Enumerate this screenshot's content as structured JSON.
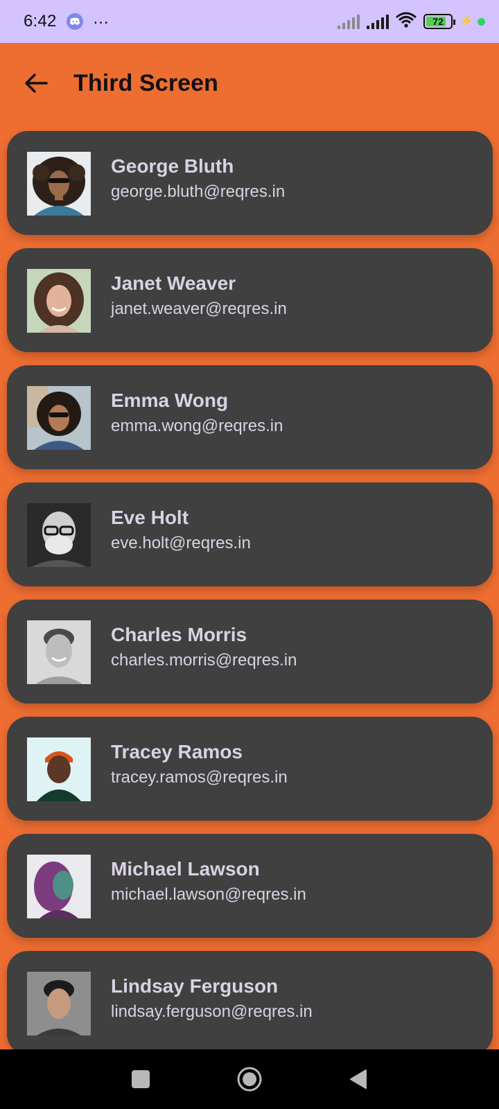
{
  "status_bar": {
    "time": "6:42",
    "notification_icons": [
      "discord-icon",
      "more-dots-icon"
    ],
    "battery_level": "72",
    "charging": true
  },
  "app_bar": {
    "title": "Third Screen"
  },
  "users": [
    {
      "name": "George Bluth",
      "email": "george.bluth@reqres.in",
      "avatar_style": "curly-hair-sunglasses"
    },
    {
      "name": "Janet Weaver",
      "email": "janet.weaver@reqres.in",
      "avatar_style": "smiling-wavy-hair"
    },
    {
      "name": "Emma Wong",
      "email": "emma.wong@reqres.in",
      "avatar_style": "curly-hair-sunglasses-street"
    },
    {
      "name": "Eve Holt",
      "email": "eve.holt@reqres.in",
      "avatar_style": "bald-glasses-bw"
    },
    {
      "name": "Charles Morris",
      "email": "charles.morris@reqres.in",
      "avatar_style": "smiling-man-bw"
    },
    {
      "name": "Tracey Ramos",
      "email": "tracey.ramos@reqres.in",
      "avatar_style": "orange-beanie"
    },
    {
      "name": "Michael Lawson",
      "email": "michael.lawson@reqres.in",
      "avatar_style": "purple-hair-profile"
    },
    {
      "name": "Lindsay Ferguson",
      "email": "lindsay.ferguson@reqres.in",
      "avatar_style": "young-man-portrait"
    }
  ],
  "colors": {
    "background": "#ee6d31",
    "status_bar": "#d3c3ff",
    "card": "#404040",
    "text_on_card": "#d9d2e3",
    "title_text": "#111111"
  }
}
